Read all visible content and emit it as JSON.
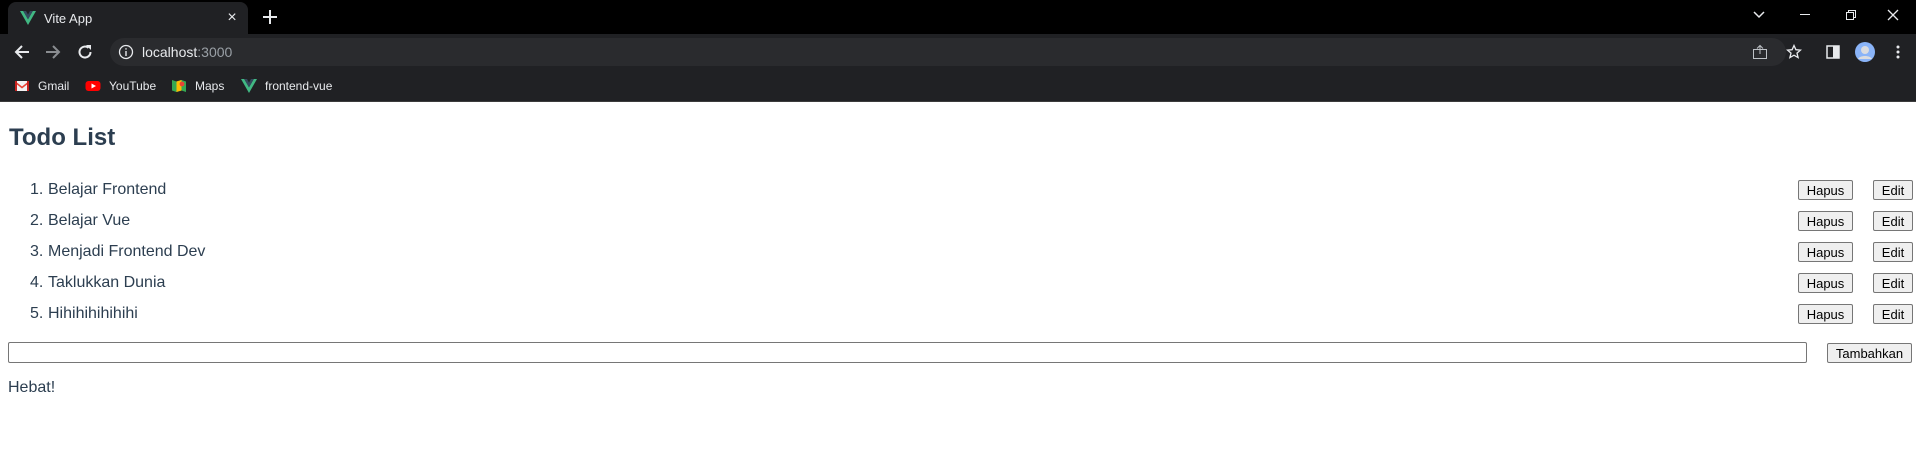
{
  "browser": {
    "tab": {
      "title": "Vite App",
      "favicon": "vue-logo-icon"
    },
    "address": {
      "host": "localhost",
      "port": ":3000"
    },
    "bookmarks": [
      {
        "label": "Gmail",
        "icon": "gmail-icon"
      },
      {
        "label": "YouTube",
        "icon": "youtube-icon"
      },
      {
        "label": "Maps",
        "icon": "maps-icon"
      },
      {
        "label": "frontend-vue",
        "icon": "vue-logo-icon"
      }
    ],
    "colors": {
      "chrome_bg": "#202124",
      "titlebar_bg": "#000000",
      "text": "#e8eaed"
    }
  },
  "app": {
    "title": "Todo List",
    "todos": [
      {
        "num": "1.",
        "text": "Belajar Frontend"
      },
      {
        "num": "2.",
        "text": "Belajar Vue"
      },
      {
        "num": "3.",
        "text": "Menjadi Frontend Dev"
      },
      {
        "num": "4.",
        "text": "Taklukkan Dunia"
      },
      {
        "num": "5.",
        "text": "Hihihihihihihi"
      }
    ],
    "delete_label": "Hapus",
    "edit_label": "Edit",
    "input": {
      "value": "",
      "placeholder": ""
    },
    "add_label": "Tambahkan",
    "status": "Hebat!",
    "colors": {
      "text": "#2c3e50"
    }
  }
}
